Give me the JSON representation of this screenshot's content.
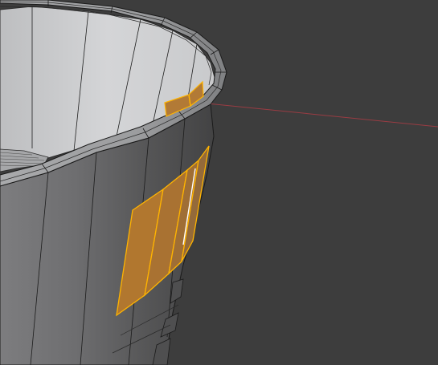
{
  "viewport": {
    "mode": "edit-mode-face-select",
    "object": "cylinder-bucket-mesh",
    "selected_faces": 4,
    "colors": {
      "background": "#3d3d3d",
      "mesh_light": "#cfcfd1",
      "mesh_mid": "#9a9a9c",
      "mesh_dark": "#565656",
      "wire": "#1c1c1c",
      "x_axis": "#9a3c43",
      "selection_fill": "#b27a36",
      "selection_edge": "#ffb400",
      "active_edge": "#ffffff"
    }
  }
}
